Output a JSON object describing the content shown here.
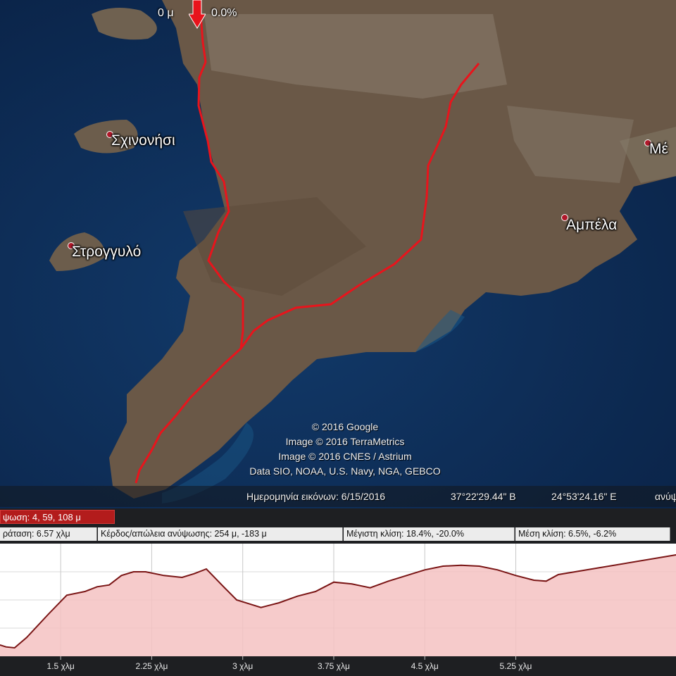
{
  "map": {
    "places": [
      {
        "name": "Σχινονήσι"
      },
      {
        "name": "Στρογγυλό"
      },
      {
        "name": "Αμπέλα"
      },
      {
        "name": "Μέ"
      }
    ],
    "start_marker": {
      "distance": "0 μ",
      "slope": "0.0%"
    },
    "credits": [
      "© 2016 Google",
      "Image © 2016 TerraMetrics",
      "Image © 2016 CNES / Astrium",
      "Data SIO, NOAA, U.S. Navy, NGA, GEBCO"
    ],
    "status": {
      "imagery_date": "Ημερομηνία εικόνων: 6/15/2016",
      "lat": "37°22'29.44\" Β",
      "lon": "24°53'24.16\" Ε",
      "elev_label": "ανύψ"
    },
    "colors": {
      "track": "#e8141c",
      "sea": "#0e2d55",
      "land": "#6b5846"
    }
  },
  "profile": {
    "elevation_summary": "ψωση: 4, 59, 108 μ",
    "stats": [
      "ράταση: 6.57 χλμ",
      "Κέρδος/απώλεια ανύψωσης: 254 μ, -183 μ",
      "Μέγιστη κλίση: 18.4%, -20.0%",
      "Μέση κλίση: 6.5%, -6.2%"
    ],
    "colors": {
      "line": "#7a1515",
      "fill": "#f4c2c2",
      "accent": "#b31c1c"
    }
  },
  "chart_data": {
    "type": "area",
    "xlabel": "",
    "ylabel": "",
    "x_tick_labels": [
      "1.5 χλμ",
      "2.25 χλμ",
      "3 χλμ",
      "3.75 χλμ",
      "4.5 χλμ",
      "5.25 χλμ"
    ],
    "x_ticks": [
      1.5,
      2.25,
      3.0,
      3.75,
      4.5,
      5.25
    ],
    "xlim": [
      1.0,
      6.57
    ],
    "ylim": [
      0,
      120
    ],
    "grid": true,
    "series": [
      {
        "x": [
          1.0,
          1.05,
          1.12,
          1.22,
          1.4,
          1.55,
          1.7,
          1.8,
          1.9,
          2.0,
          2.1,
          2.2,
          2.35,
          2.5,
          2.6,
          2.7,
          2.85,
          2.95,
          3.05,
          3.15,
          3.3,
          3.45,
          3.6,
          3.75,
          3.9,
          4.05,
          4.2,
          4.35,
          4.5,
          4.65,
          4.8,
          4.95,
          5.1,
          5.25,
          5.4,
          5.5,
          5.6,
          6.57
        ],
        "y": [
          12,
          10,
          9,
          20,
          45,
          65,
          69,
          74,
          76,
          86,
          90,
          90,
          86,
          84,
          88,
          93,
          73,
          60,
          56,
          52,
          57,
          64,
          69,
          79,
          77,
          73,
          80,
          86,
          92,
          96,
          97,
          96,
          92,
          86,
          81,
          80,
          87,
          108
        ]
      }
    ]
  }
}
